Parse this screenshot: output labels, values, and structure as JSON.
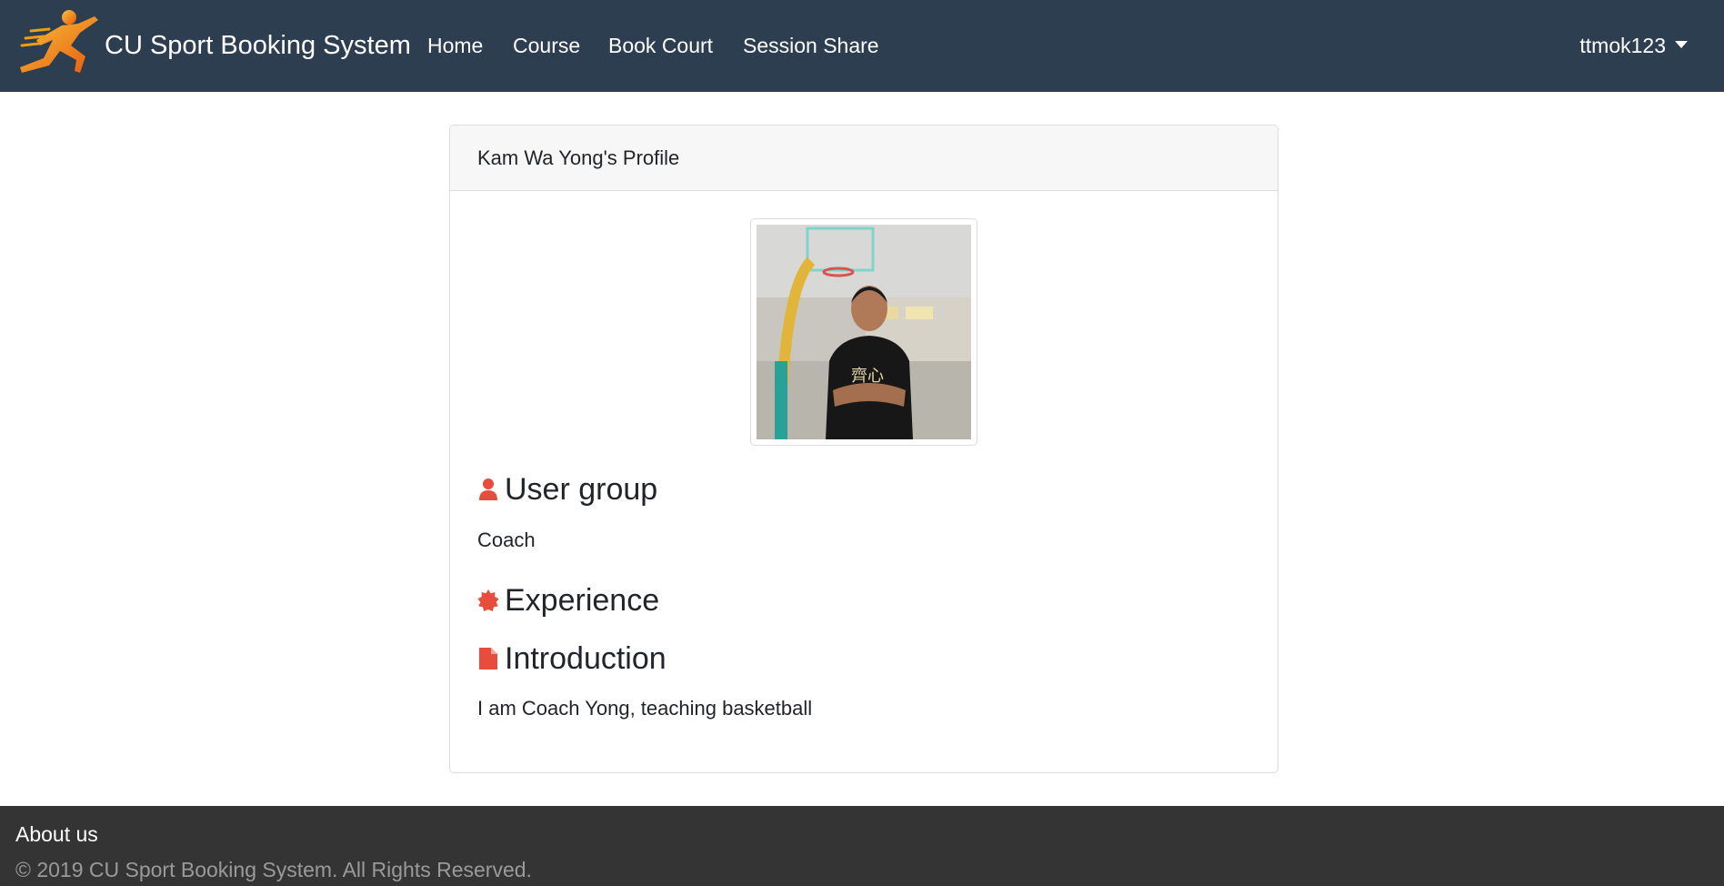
{
  "navbar": {
    "brand": "CU Sport Booking System",
    "links": [
      "Home",
      "Course",
      "Book Court",
      "Session Share"
    ],
    "user": "ttmok123"
  },
  "profile": {
    "header": "Kam Wa Yong's Profile",
    "sections": {
      "user_group": {
        "title": "User group",
        "value": "Coach",
        "icon": "user-icon"
      },
      "experience": {
        "title": "Experience",
        "icon": "certificate-icon"
      },
      "introduction": {
        "title": "Introduction",
        "value": "I am Coach Yong, teaching basketball",
        "icon": "file-icon"
      }
    }
  },
  "footer": {
    "title": "About us",
    "copyright": "© 2019 CU Sport Booking System. All Rights Reserved."
  },
  "colors": {
    "navbar": "#2c3e50",
    "accent_icon": "#e74c3c",
    "footer": "#343434"
  }
}
